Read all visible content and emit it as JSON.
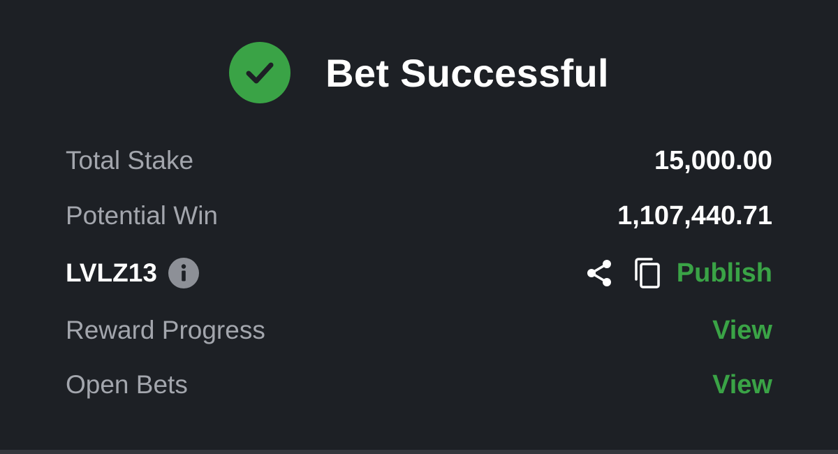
{
  "header": {
    "title": "Bet Successful",
    "icon": "check-circle-icon"
  },
  "summary": {
    "total_stake": {
      "label": "Total Stake",
      "value": "15,000.00"
    },
    "potential_win": {
      "label": "Potential Win",
      "value": "1,107,440.71"
    },
    "booking": {
      "code": "LVLZ13",
      "info_icon": "info-icon",
      "share_icon": "share-icon",
      "copy_icon": "copy-icon",
      "publish_label": "Publish"
    },
    "reward_progress": {
      "label": "Reward Progress",
      "action": "View"
    },
    "open_bets": {
      "label": "Open Bets",
      "action": "View"
    }
  },
  "colors": {
    "background": "#1d2025",
    "accent_green": "#3aa346",
    "muted_text": "#a3a6ad",
    "primary_text": "#ffffff"
  }
}
